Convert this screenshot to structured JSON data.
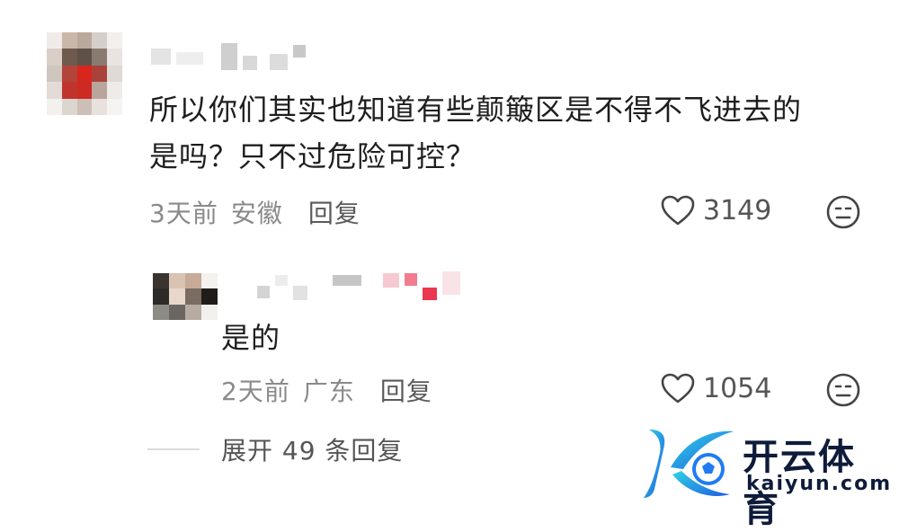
{
  "comment": {
    "text_line1": "所以你们其实也知道有些颠簸区是不得不飞进去的",
    "text_line2": "是吗？只不过危险可控？",
    "time": "3天前",
    "location": "安徽",
    "reply_label": "回复",
    "like_count": "3149"
  },
  "reply": {
    "text": "是的",
    "time": "2天前",
    "location": "广东",
    "reply_label": "回复",
    "like_count": "1054"
  },
  "expand_label": "展开 49 条回复",
  "watermark": {
    "name_cn": "开云体育",
    "name_en": "kaiyun.com"
  },
  "colors": {
    "meta": "#8a8a8a",
    "brand_blue": "#1f7cf0",
    "brand_cyan": "#2fd3e6",
    "brand_dark": "#0e1b3a"
  },
  "icons": {
    "like": "heart-outline-icon",
    "dislike": "meh-face-icon"
  }
}
